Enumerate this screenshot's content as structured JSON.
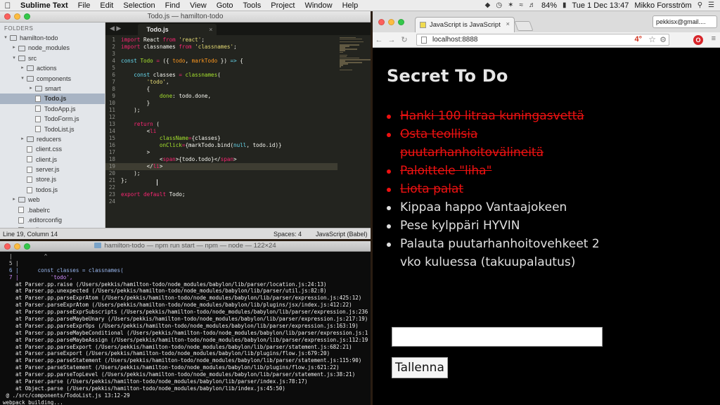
{
  "menubar": {
    "app_name": "Sublime Text",
    "items": [
      "File",
      "Edit",
      "Selection",
      "Find",
      "View",
      "Goto",
      "Tools",
      "Project",
      "Window",
      "Help"
    ],
    "battery": "84%",
    "clock": "Tue 1 Dec  13:47",
    "user": "Mikko Forsström"
  },
  "sublime": {
    "window_title": "Todo.js — hamilton-todo",
    "sidebar_header": "FOLDERS",
    "tree": [
      {
        "label": "hamilton-todo",
        "indent": 0,
        "type": "folder",
        "open": true
      },
      {
        "label": "node_modules",
        "indent": 1,
        "type": "folder",
        "open": false
      },
      {
        "label": "src",
        "indent": 1,
        "type": "folder",
        "open": true
      },
      {
        "label": "actions",
        "indent": 2,
        "type": "folder",
        "open": false
      },
      {
        "label": "components",
        "indent": 2,
        "type": "folder",
        "open": true
      },
      {
        "label": "smart",
        "indent": 3,
        "type": "folder",
        "open": false
      },
      {
        "label": "Todo.js",
        "indent": 3,
        "type": "file",
        "selected": true
      },
      {
        "label": "TodoApp.js",
        "indent": 3,
        "type": "file"
      },
      {
        "label": "TodoForm.js",
        "indent": 3,
        "type": "file"
      },
      {
        "label": "TodoList.js",
        "indent": 3,
        "type": "file"
      },
      {
        "label": "reducers",
        "indent": 2,
        "type": "folder",
        "open": false
      },
      {
        "label": "client.css",
        "indent": 2,
        "type": "file"
      },
      {
        "label": "client.js",
        "indent": 2,
        "type": "file"
      },
      {
        "label": "server.js",
        "indent": 2,
        "type": "file"
      },
      {
        "label": "store.js",
        "indent": 2,
        "type": "file"
      },
      {
        "label": "todos.js",
        "indent": 2,
        "type": "file"
      },
      {
        "label": "web",
        "indent": 1,
        "type": "folder",
        "open": false
      },
      {
        "label": ".babelrc",
        "indent": 1,
        "type": "file"
      },
      {
        "label": ".editorconfig",
        "indent": 1,
        "type": "file"
      },
      {
        "label": ".eslintrc",
        "indent": 1,
        "type": "file"
      }
    ],
    "tab_label": "Todo.js",
    "code_lines": [
      {
        "n": "1",
        "t": [
          [
            "k",
            "import"
          ],
          [
            "ct",
            " React "
          ],
          [
            "k",
            "from"
          ],
          [
            "ct",
            " "
          ],
          [
            "s",
            "'react'"
          ],
          [
            "ct",
            ";"
          ]
        ]
      },
      {
        "n": "2",
        "t": [
          [
            "k",
            "import"
          ],
          [
            "ct",
            " classnames "
          ],
          [
            "k",
            "from"
          ],
          [
            "ct",
            " "
          ],
          [
            "s",
            "'classnames'"
          ],
          [
            "ct",
            ";"
          ]
        ]
      },
      {
        "n": "3",
        "t": []
      },
      {
        "n": "4",
        "t": [
          [
            "c",
            "const"
          ],
          [
            "ct",
            " "
          ],
          [
            "f",
            "Todo"
          ],
          [
            "ct",
            " "
          ],
          [
            "k",
            "="
          ],
          [
            "ct",
            " ({ "
          ],
          [
            "v",
            "todo"
          ],
          [
            "ct",
            ", "
          ],
          [
            "v",
            "markTodo"
          ],
          [
            "ct",
            " }) "
          ],
          [
            "c",
            "=>"
          ],
          [
            "ct",
            " {"
          ]
        ]
      },
      {
        "n": "5",
        "t": []
      },
      {
        "n": "6",
        "t": [
          [
            "ct",
            "    "
          ],
          [
            "c",
            "const"
          ],
          [
            "ct",
            " classes "
          ],
          [
            "k",
            "="
          ],
          [
            "ct",
            " "
          ],
          [
            "f",
            "classnames"
          ],
          [
            "ct",
            "("
          ]
        ]
      },
      {
        "n": "7",
        "t": [
          [
            "ct",
            "        "
          ],
          [
            "s",
            "'todo'"
          ],
          [
            "ct",
            ","
          ]
        ]
      },
      {
        "n": "8",
        "t": [
          [
            "ct",
            "        {"
          ]
        ]
      },
      {
        "n": "9",
        "t": [
          [
            "ct",
            "            "
          ],
          [
            "f",
            "done"
          ],
          [
            "ct",
            ": todo.done,"
          ]
        ]
      },
      {
        "n": "10",
        "t": [
          [
            "ct",
            "        }"
          ]
        ]
      },
      {
        "n": "11",
        "t": [
          [
            "ct",
            "    );"
          ]
        ]
      },
      {
        "n": "12",
        "t": []
      },
      {
        "n": "13",
        "t": [
          [
            "ct",
            "    "
          ],
          [
            "k",
            "return"
          ],
          [
            "ct",
            " ("
          ]
        ]
      },
      {
        "n": "14",
        "t": [
          [
            "ct",
            "        <"
          ],
          [
            "k",
            "li"
          ]
        ]
      },
      {
        "n": "15",
        "t": [
          [
            "ct",
            "            "
          ],
          [
            "f",
            "className"
          ],
          [
            "k",
            "="
          ],
          [
            "ct",
            "{classes}"
          ]
        ]
      },
      {
        "n": "16",
        "t": [
          [
            "ct",
            "            "
          ],
          [
            "f",
            "onClick"
          ],
          [
            "k",
            "="
          ],
          [
            "ct",
            "{markTodo.bind("
          ],
          [
            "c",
            "null"
          ],
          [
            "ct",
            ", todo.id)}"
          ]
        ]
      },
      {
        "n": "17",
        "t": [
          [
            "ct",
            "        >"
          ]
        ]
      },
      {
        "n": "18",
        "t": [
          [
            "ct",
            "            <"
          ],
          [
            "k",
            "span"
          ],
          [
            "ct",
            ">{todo.todo}</"
          ],
          [
            "k",
            "span"
          ],
          [
            "ct",
            ">"
          ]
        ]
      },
      {
        "n": "19",
        "t": [
          [
            "ct",
            "        </"
          ],
          [
            "k",
            "li"
          ],
          [
            "ct",
            ">"
          ]
        ],
        "hl": true
      },
      {
        "n": "20",
        "t": [
          [
            "ct",
            "    );"
          ]
        ]
      },
      {
        "n": "21",
        "t": [
          [
            "ct",
            "};"
          ]
        ]
      },
      {
        "n": "22",
        "t": []
      },
      {
        "n": "23",
        "t": [
          [
            "k",
            "export"
          ],
          [
            "ct",
            " "
          ],
          [
            "k",
            "default"
          ],
          [
            "ct",
            " Todo;"
          ]
        ]
      },
      {
        "n": "24",
        "t": []
      }
    ],
    "status_position": "Line 19, Column 14",
    "status_spaces": "Spaces: 4",
    "status_syntax": "JavaScript (Babel)"
  },
  "terminal": {
    "title": "hamilton-todo — npm run start — npm — node — 122×24",
    "lines": [
      {
        "t": "  |          ^",
        "kind": "gut"
      },
      {
        "t": "  5 |",
        "kind": "gut"
      },
      {
        "t": "  6 |      const classes = classnames(",
        "kind": "code6"
      },
      {
        "t": "  7 |          'todo',",
        "kind": "code7"
      },
      {
        "t": "    at Parser.pp.raise (/Users/pekkis/hamilton-todo/node_modules/babylon/lib/parser/location.js:24:13)"
      },
      {
        "t": "    at Parser.pp.unexpected (/Users/pekkis/hamilton-todo/node_modules/babylon/lib/parser/util.js:82:8)"
      },
      {
        "t": "    at Parser.pp.parseExprAtom (/Users/pekkis/hamilton-todo/node_modules/babylon/lib/parser/expression.js:425:12)"
      },
      {
        "t": "    at Parser.parseExprAtom (/Users/pekkis/hamilton-todo/node_modules/babylon/lib/plugins/jsx/index.js:412:22)"
      },
      {
        "t": "    at Parser.pp.parseExprSubscripts (/Users/pekkis/hamilton-todo/node_modules/babylon/lib/parser/expression.js:236:19)"
      },
      {
        "t": "    at Parser.pp.parseMaybeUnary (/Users/pekkis/hamilton-todo/node_modules/babylon/lib/parser/expression.js:217:19)"
      },
      {
        "t": "    at Parser.pp.parseExprOps (/Users/pekkis/hamilton-todo/node_modules/babylon/lib/parser/expression.js:163:19)"
      },
      {
        "t": "    at Parser.pp.parseMaybeConditional (/Users/pekkis/hamilton-todo/node_modules/babylon/lib/parser/expression.js:145:19)"
      },
      {
        "t": "    at Parser.pp.parseMaybeAssign (/Users/pekkis/hamilton-todo/node_modules/babylon/lib/parser/expression.js:112:19)"
      },
      {
        "t": "    at Parser.pp.parseExport (/Users/pekkis/hamilton-todo/node_modules/babylon/lib/parser/statement.js:682:21)"
      },
      {
        "t": "    at Parser.parseExport (/Users/pekkis/hamilton-todo/node_modules/babylon/lib/plugins/flow.js:679:20)"
      },
      {
        "t": "    at Parser.pp.parseStatement (/Users/pekkis/hamilton-todo/node_modules/babylon/lib/parser/statement.js:115:90)"
      },
      {
        "t": "    at Parser.parseStatement (/Users/pekkis/hamilton-todo/node_modules/babylon/lib/plugins/flow.js:621:22)"
      },
      {
        "t": "    at Parser.pp.parseTopLevel (/Users/pekkis/hamilton-todo/node_modules/babylon/lib/parser/statement.js:38:21)"
      },
      {
        "t": "    at Parser.parse (/Users/pekkis/hamilton-todo/node_modules/babylon/lib/parser/index.js:78:17)"
      },
      {
        "t": "    at Object.parse (/Users/pekkis/hamilton-todo/node_modules/babylon/lib/index.js:45:50)"
      },
      {
        "t": " @ ./src/components/TodoList.js 13:12-29"
      },
      {
        "t": "webpack building..."
      }
    ]
  },
  "chrome": {
    "tab_title": "JavaScript is JavaScript",
    "user_chip": "pekkisx@gmail....",
    "url": "localhost:8888",
    "badge": "4°",
    "ext_label": "O",
    "page": {
      "heading": "Secret To Do",
      "todos": [
        {
          "text": "Hanki 100 litraa kuningasvettä",
          "done": true
        },
        {
          "text": "Osta teollisia puutarhanhoitovälineitä",
          "done": true
        },
        {
          "text": "Paloittele \"liha\"",
          "done": true
        },
        {
          "text": "Liota palat",
          "done": true
        },
        {
          "text": "Kippaa happo Vantaajokeen",
          "done": false
        },
        {
          "text": "Pese kylppäri HYVIN",
          "done": false
        },
        {
          "text": "Palauta puutarhanhoitovehkeet 2 vko kuluessa (takuupalautus)",
          "done": false
        }
      ],
      "input_value": "",
      "save_label": "Tallenna"
    }
  },
  "colors": {
    "done_red": "#ee1111",
    "editor_bg": "#23241f",
    "page_bg": "#000000"
  }
}
